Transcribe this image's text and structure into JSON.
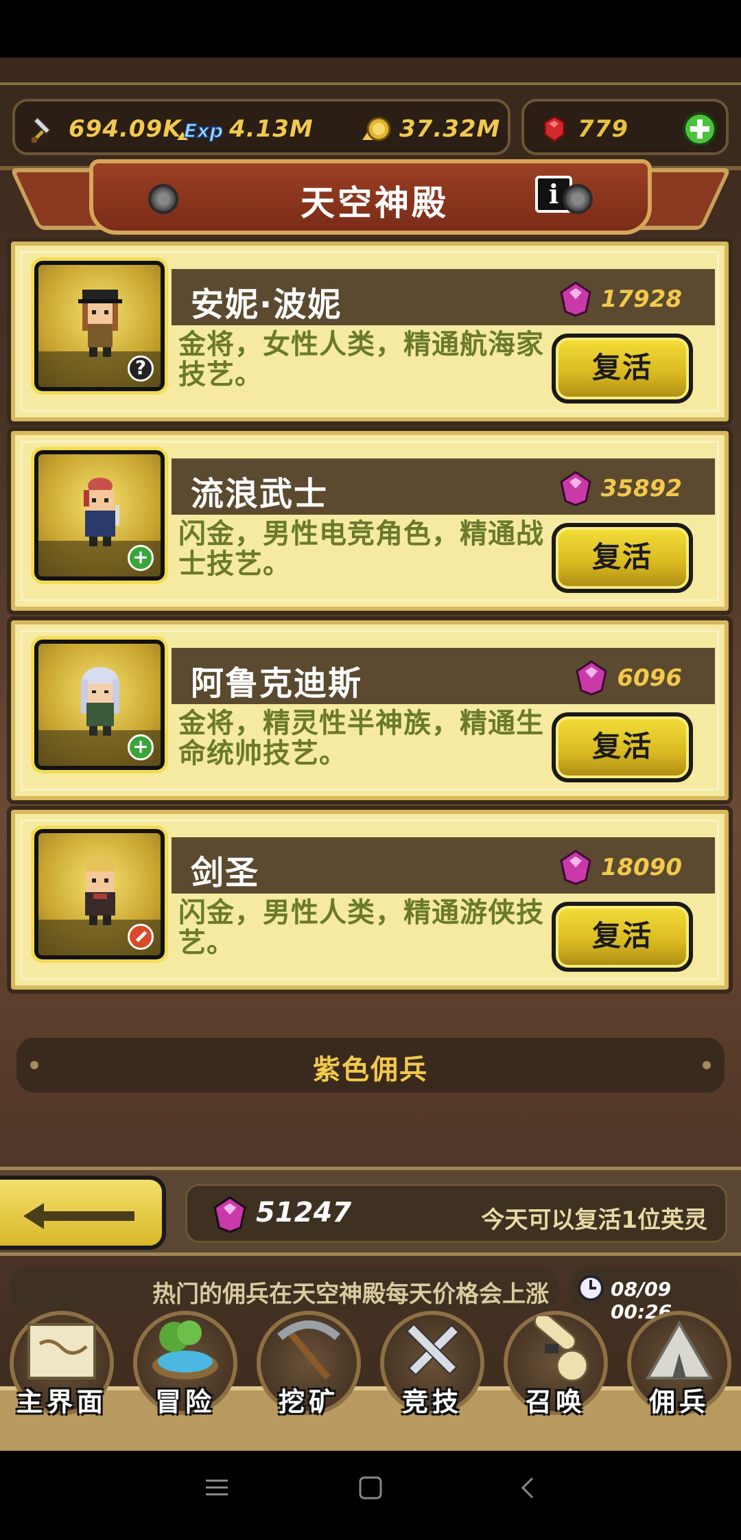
{
  "resources": {
    "attack": "694.09K",
    "exp": "4.13M",
    "gold": "37.32M",
    "ruby": "779",
    "exp_icon_text": "Exp"
  },
  "header": {
    "title": "天空神殿",
    "info_label": "i"
  },
  "heroes": [
    {
      "name": "安妮·波妮",
      "price": "17928",
      "desc": "金将，女性人类，精通航海家技艺。",
      "badge": "?",
      "revive_label": "复活"
    },
    {
      "name": "流浪武士",
      "price": "35892",
      "desc": "闪金，男性电竞角色，精通战士技艺。",
      "badge": "+",
      "revive_label": "复活"
    },
    {
      "name": "阿鲁克迪斯",
      "price": "6096",
      "desc": "金将，精灵性半神族，精通生命统帅技艺。",
      "badge": "+",
      "revive_label": "复活"
    },
    {
      "name": "剑圣",
      "price": "18090",
      "desc": "闪金，男性人类，精通游侠技艺。",
      "badge": "",
      "revive_label": "复活"
    }
  ],
  "section": {
    "purple_label": "紫色佣兵"
  },
  "footer": {
    "gem_count": "51247",
    "revive_note": "今天可以复活1位英灵",
    "ticker": "热门的佣兵在天空神殿每天价格会上涨",
    "datetime": "08/09 00:26"
  },
  "nav": [
    {
      "label": "主界面",
      "icon": "map-scroll-icon"
    },
    {
      "label": "冒险",
      "icon": "island-icon"
    },
    {
      "label": "挖矿",
      "icon": "pickaxe-icon"
    },
    {
      "label": "竞技",
      "icon": "crossed-swords-icon"
    },
    {
      "label": "召唤",
      "icon": "summon-scroll-icon"
    },
    {
      "label": "佣兵",
      "icon": "tent-icon"
    }
  ],
  "colors": {
    "card_bg": "#f5eaa0",
    "gold_text": "#f2c94c",
    "button_yellow": "#e8cc2a",
    "desc_green": "#6a7a2a",
    "banner_red": "#8a3a20"
  }
}
